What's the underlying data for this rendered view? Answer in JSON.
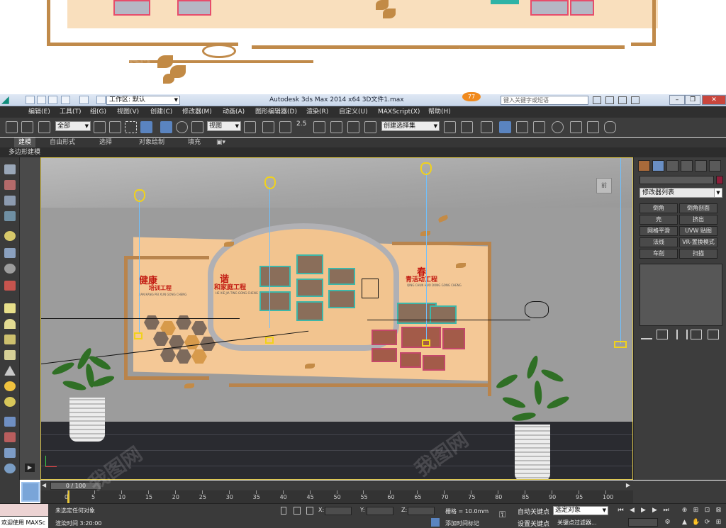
{
  "app": {
    "title": "Autodesk 3ds Max  2014 x64      3D文件1.max",
    "workspace": "工作区: 默认",
    "search_placeholder": "键入关键字或短语",
    "badge": "77"
  },
  "menus": [
    "编辑(E)",
    "工具(T)",
    "组(G)",
    "视图(V)",
    "创建(C)",
    "修改器(M)",
    "动画(A)",
    "图形编辑器(D)",
    "渲染(R)",
    "自定义(U)",
    "MAXScript(X)",
    "帮助(H)"
  ],
  "toolbar": {
    "filter": "全部",
    "coord_system": "视图",
    "snap_value": "2.5",
    "selection_set": "创建选择集"
  },
  "ribbon": {
    "tabs": [
      "建模",
      "自由形式",
      "选择",
      "对象绘制",
      "填充"
    ],
    "sub_label": "多边形建模"
  },
  "viewport": {
    "viewcube_label": "前",
    "headings": {
      "left_title": "健康",
      "left_sub": "培训工程",
      "left_pinyin": "JIAN KANG PEI XUN GONG CHENG",
      "mid_title": "谐",
      "mid_sub": "和家庭工程",
      "mid_pinyin": "HE XIE JIA TING GONG CHENG",
      "right_title": "春",
      "right_sub": "青活动工程",
      "right_pinyin": "QING CHUN HUO DONG GONG CHENG"
    }
  },
  "command_panel": {
    "modifier_list": "修改器列表",
    "buttons": [
      "倒角",
      "倒角剖面",
      "壳",
      "挤出",
      "网格平滑",
      "UVW 贴图",
      "法线",
      "VR-置换模式",
      "车削",
      "扫描"
    ]
  },
  "timeline": {
    "frame": "0 / 100",
    "ticks": [
      "0",
      "5",
      "10",
      "15",
      "20",
      "25",
      "30",
      "35",
      "40",
      "45",
      "50",
      "55",
      "60",
      "65",
      "70",
      "75",
      "80",
      "85",
      "90",
      "95",
      "100"
    ]
  },
  "status": {
    "maxscript": "欢迎使用  MAXSc",
    "selection": "未选定任何对象",
    "render_time": "渲染时间  3:20:00",
    "x_label": "X:",
    "y_label": "Y:",
    "z_label": "Z:",
    "grid": "栅格 = 10.0mm",
    "add_time_tag": "添加时间标记",
    "auto_key": "自动关键点",
    "set_key": "设置关键点",
    "selected_object": "选定对象",
    "key_filters": "关键点过滤器..."
  },
  "colors": {
    "accent_blue": "#5a84c0",
    "board_peach": "#f4c896",
    "frame_brown": "#b9844c",
    "heading_red": "#c21b12",
    "light_blue": "#6fc1ff",
    "bulb_yellow": "#f1d21c"
  },
  "icons": [
    "save-icon",
    "undo-icon",
    "redo-icon",
    "select-icon",
    "move-icon",
    "rotate-icon",
    "scale-icon",
    "render-icon",
    "teapot-icon",
    "key-icon",
    "play-icon"
  ]
}
